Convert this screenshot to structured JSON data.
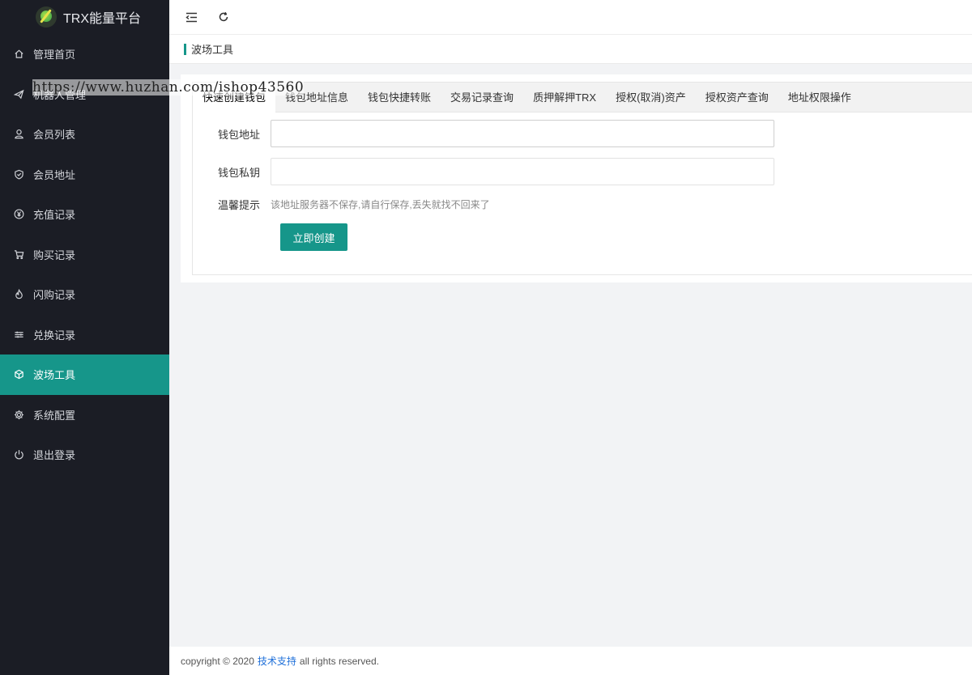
{
  "app": {
    "title": "TRX能量平台",
    "accent_color": "#16968a",
    "sidebar_bg": "#1b1d25"
  },
  "sidebar": {
    "items": [
      {
        "label": "管理首页",
        "icon": "home-icon"
      },
      {
        "label": "机器人管理",
        "icon": "send-icon"
      },
      {
        "label": "会员列表",
        "icon": "user-icon"
      },
      {
        "label": "会员地址",
        "icon": "shield-icon"
      },
      {
        "label": "充值记录",
        "icon": "yen-icon"
      },
      {
        "label": "购买记录",
        "icon": "cart-icon"
      },
      {
        "label": "闪购记录",
        "icon": "fire-icon"
      },
      {
        "label": "兑换记录",
        "icon": "sliders-icon"
      },
      {
        "label": "波场工具",
        "icon": "cube-icon",
        "active": true
      },
      {
        "label": "系统配置",
        "icon": "gear-icon"
      },
      {
        "label": "退出登录",
        "icon": "power-icon"
      }
    ]
  },
  "topbar": {
    "menu_toggle_icon": "menu-fold-icon",
    "refresh_icon": "refresh-icon"
  },
  "breadcrumb": {
    "title": "波场工具"
  },
  "tabs": [
    {
      "label": "快速创建钱包",
      "active": true
    },
    {
      "label": "钱包地址信息"
    },
    {
      "label": "钱包快捷转账"
    },
    {
      "label": "交易记录查询"
    },
    {
      "label": "质押解押TRX"
    },
    {
      "label": "授权(取消)资产"
    },
    {
      "label": "授权资产查询"
    },
    {
      "label": "地址权限操作"
    }
  ],
  "form": {
    "address_label": "钱包地址",
    "address_value": "",
    "private_key_label": "钱包私钥",
    "private_key_value": "",
    "tip_label": "温馨提示",
    "tip_text": "该地址服务器不保存,请自行保存,丢失就找不回来了",
    "submit_label": "立即创建"
  },
  "watermark": "https://www.huzhan.com/ishop43560",
  "footer": {
    "prefix": "copyright © 2020",
    "link": "技术支持",
    "suffix": "all rights reserved."
  }
}
